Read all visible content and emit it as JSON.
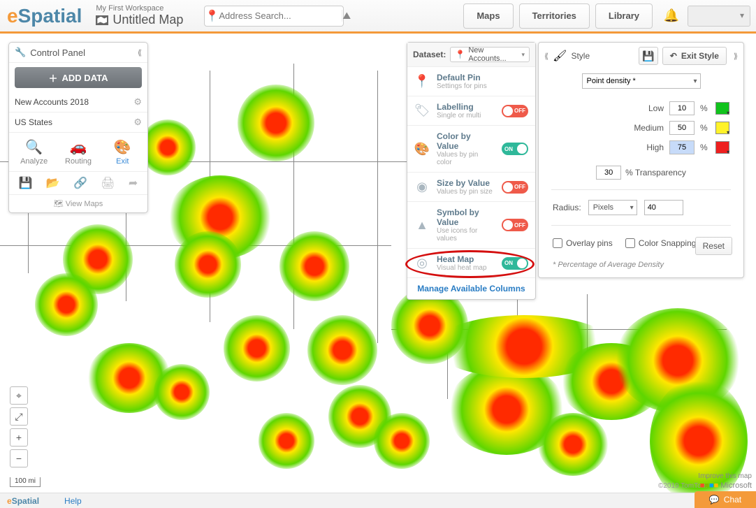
{
  "brand": {
    "left": "e",
    "right": "Spatial"
  },
  "workspace": {
    "name": "My First Workspace",
    "map_title": "Untitled Map"
  },
  "search": {
    "placeholder": "Address Search..."
  },
  "nav": {
    "maps": "Maps",
    "territories": "Territories",
    "library": "Library"
  },
  "control_panel": {
    "title": "Control Panel",
    "add_data": "ADD DATA",
    "datasets": [
      "New Accounts 2018",
      "US States"
    ],
    "actions": {
      "analyze": "Analyze",
      "routing": "Routing",
      "exit": "Exit"
    },
    "view_maps": "View Maps"
  },
  "dataset_panel": {
    "label": "Dataset:",
    "selected": "New Accounts...",
    "items": [
      {
        "title": "Default Pin",
        "sub": "Settings for pins",
        "toggle": null
      },
      {
        "title": "Labelling",
        "sub": "Single or multi",
        "toggle": "OFF"
      },
      {
        "title": "Color by Value",
        "sub": "Values by pin color",
        "toggle": "ON"
      },
      {
        "title": "Size by Value",
        "sub": "Values by pin size",
        "toggle": "OFF"
      },
      {
        "title": "Symbol by Value",
        "sub": "Use icons for values",
        "toggle": "OFF"
      },
      {
        "title": "Heat Map",
        "sub": "Visual heat map",
        "toggle": "ON"
      }
    ],
    "footer": "Manage Available Columns"
  },
  "style_panel": {
    "title": "Style",
    "exit": "Exit Style",
    "density_mode": "Point density *",
    "levels": {
      "low": {
        "label": "Low",
        "value": "10",
        "color": "#11c31d"
      },
      "medium": {
        "label": "Medium",
        "value": "50",
        "color": "#fff22a"
      },
      "high": {
        "label": "High",
        "value": "75",
        "color": "#ee1f1f"
      }
    },
    "pct": "%",
    "transparency": {
      "value": "30",
      "label": "% Transparency"
    },
    "radius": {
      "label": "Radius:",
      "unit": "Pixels",
      "value": "40"
    },
    "overlay_pins": "Overlay pins",
    "color_snapping": "Color Snapping",
    "reset": "Reset",
    "footnote": "* Percentage of Average Density"
  },
  "map_controls": {
    "scale": "100 mi"
  },
  "attribution": {
    "tomtom": "©2019 TomTom",
    "microsoft": "Microsoft",
    "improve": "Improve this map"
  },
  "footer": {
    "help": "Help",
    "chat": "Chat"
  }
}
